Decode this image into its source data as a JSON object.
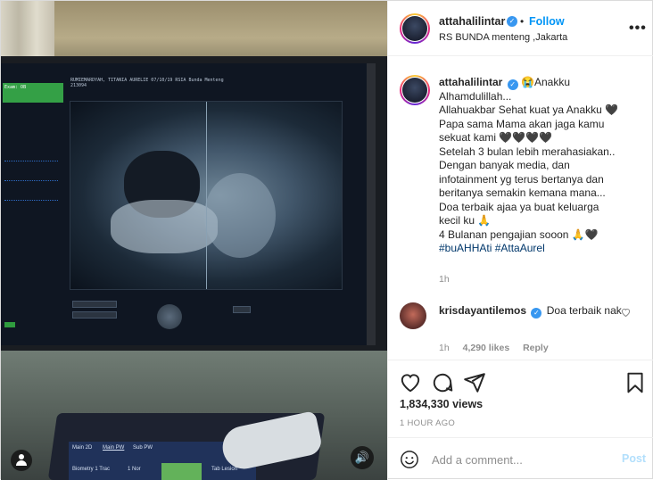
{
  "post": {
    "author": "attahalilintar",
    "follow_label": "Follow",
    "follow_dot": "•",
    "location": "RS BUNDA menteng ,Jakarta",
    "more_label": "•••",
    "verified_mark": "✓"
  },
  "caption": {
    "username": "attahalilintar",
    "lines": [
      "😭Anakku",
      "Alhamdulillah...",
      "Allahuakbar Sehat kuat ya Anakku 🖤",
      "Papa sama Mama akan jaga kamu",
      "sekuat kami 🖤🖤🖤🖤",
      "Setelah 3 bulan lebih merahasiakan..",
      "Dengan banyak media, dan",
      "infotainment yg terus bertanya dan",
      "beritanya semakin kemana mana...",
      "Doa terbaik ajaa ya buat keluarga",
      "kecil ku 🙏",
      "4 Bulanan pengajian sooon 🙏🖤"
    ],
    "hashtags": "#buAHHAti #AttaAurel",
    "time": "1h"
  },
  "comment": {
    "username": "krisdayantilemos",
    "text": "Doa terbaik nak",
    "time": "1h",
    "likes": "4,290 likes",
    "reply_label": "Reply"
  },
  "stats": {
    "views": "1,834,330 views",
    "posted_ago": "1 HOUR AGO"
  },
  "comment_box": {
    "placeholder": "Add a comment...",
    "post_label": "Post"
  },
  "media": {
    "screen_header": "RUMIEMARDYAH, TITANIA AURELIE 07/10/19        RSIA Bunda Menteng",
    "screen_header2": "213094",
    "green_tag": "Exam: OB",
    "kb_tab1": "Main 2D",
    "kb_tab2": "Main PW",
    "kb_tab3": "Sub PW",
    "kb_btn1": "Biometry 1 Trac",
    "kb_btn2": "1 Nor",
    "kb_btn3": "Tab Lesion",
    "sound_icon": "🔊"
  },
  "colors": {
    "link": "#0095f6",
    "hashtag": "#00376b",
    "muted": "#8e8e8e",
    "post_disabled": "#b2dffc"
  }
}
